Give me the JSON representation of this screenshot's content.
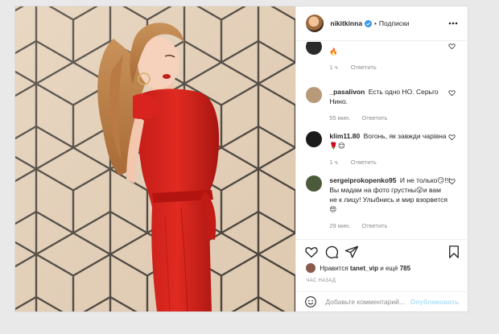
{
  "header": {
    "username": "nikitkinna",
    "separator": "•",
    "follow_label": "Подписки"
  },
  "comments": [
    {
      "user": "",
      "text": "🔥",
      "time": "1 ч.",
      "reply": "Ответить",
      "avatar_color": "#2b2b2b"
    },
    {
      "user": "_pasalivon",
      "text": "Есть одно НО. Серьго Нино.",
      "time": "55 мин.",
      "reply": "Ответить",
      "avatar_color": "#b89a7a"
    },
    {
      "user": "klim11.80",
      "text": "Вогонь, як завжди чарівна🌹😊",
      "time": "1 ч.",
      "reply": "Ответить",
      "avatar_color": "#1a1a1a"
    },
    {
      "user": "sergeiprokopenko95",
      "text": "И не только😏!!! Вы мадам на фото грустны😮и вам не к лицу! Улыбнись и мир взорвется😍",
      "time": "29 мин.",
      "reply": "Ответить",
      "avatar_color": "#4a5a3a"
    }
  ],
  "likes": {
    "prefix": "Нравится",
    "user": "tanet_vip",
    "middle": "и ещё",
    "count": "785"
  },
  "timestamp": "ЧАС НАЗАД",
  "add_comment": {
    "placeholder": "Добавьте комментарий...",
    "publish_label": "Опубликовать"
  },
  "colors": {
    "accent": "#0095f6",
    "publish_disabled": "#b2dffc",
    "dress": "#d8231f",
    "wall": "#e4d1bc"
  }
}
